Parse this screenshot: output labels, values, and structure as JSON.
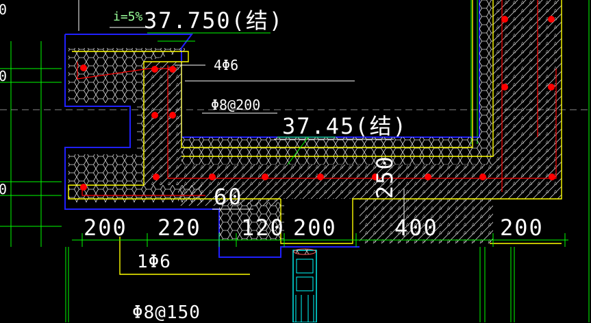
{
  "drawing": {
    "slope_note": "i=5%",
    "top_elevation": "37.750(结)",
    "inner_elevation": "37.45(结)",
    "top_rebar": "4Φ6",
    "dist_rebar": "Φ8@200",
    "bottom_rebar": "1Φ6",
    "bottom_stirrup": "Φ8@150",
    "vert_dim": "250",
    "dim_60": "60",
    "dims": [
      "200",
      "220",
      "120",
      "200",
      "400",
      "200"
    ],
    "left_edge_marks": [
      "0",
      "0",
      "0"
    ]
  },
  "colors": {
    "background": "#000000",
    "concrete_outline": "#ffff00",
    "insulation_outline": "#2020ff",
    "rebar": "#ff0000",
    "grid": "#00ff00",
    "text": "#ffffff"
  }
}
